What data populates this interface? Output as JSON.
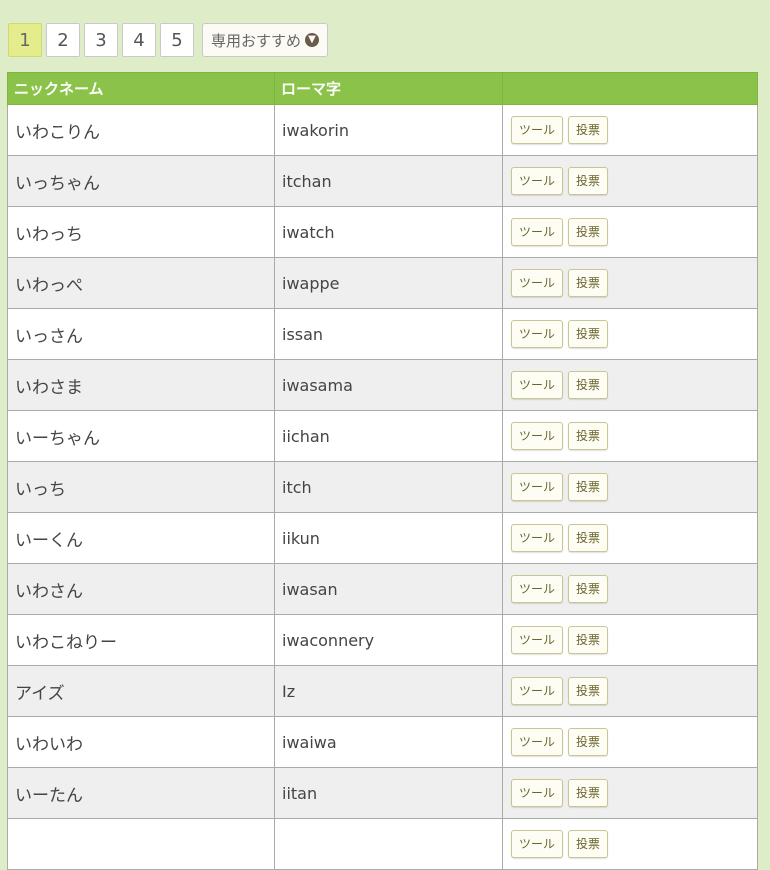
{
  "pager": {
    "pages": [
      "1",
      "2",
      "3",
      "4",
      "5"
    ],
    "active": "1",
    "recommend_label": "専用おすすめ",
    "recommend_icon": "download-circle-icon"
  },
  "table": {
    "headers": [
      "ニックネーム",
      "ローマ字",
      ""
    ],
    "tool_label": "ツール",
    "vote_label": "投票",
    "rows": [
      {
        "nickname": "いわこりん",
        "romaji": "iwakorin"
      },
      {
        "nickname": "いっちゃん",
        "romaji": "itchan"
      },
      {
        "nickname": "いわっち",
        "romaji": "iwatch"
      },
      {
        "nickname": "いわっぺ",
        "romaji": "iwappe"
      },
      {
        "nickname": "いっさん",
        "romaji": "issan"
      },
      {
        "nickname": "いわさま",
        "romaji": "iwasama"
      },
      {
        "nickname": "いーちゃん",
        "romaji": "iichan"
      },
      {
        "nickname": "いっち",
        "romaji": "itch"
      },
      {
        "nickname": "いーくん",
        "romaji": "iikun"
      },
      {
        "nickname": "いわさん",
        "romaji": "iwasan"
      },
      {
        "nickname": "いわこねりー",
        "romaji": "iwaconnery"
      },
      {
        "nickname": "アイズ",
        "romaji": "Iz"
      },
      {
        "nickname": "いわいわ",
        "romaji": "iwaiwa"
      },
      {
        "nickname": "いーたん",
        "romaji": "iitan"
      },
      {
        "nickname": "",
        "romaji": ""
      }
    ]
  },
  "colors": {
    "background": "#deecc8",
    "header": "#8bc34a",
    "active_page": "#e5ec8c",
    "row_alt": "#efefef"
  }
}
